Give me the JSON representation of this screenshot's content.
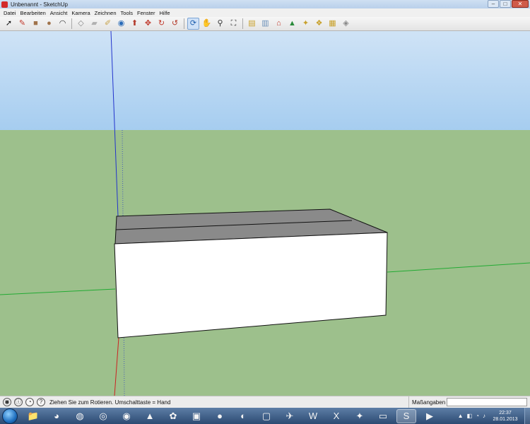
{
  "window": {
    "title": "Unbenannt - SketchUp",
    "minimize_glyph": "–",
    "maximize_glyph": "□",
    "close_glyph": "✕"
  },
  "menu": {
    "items": [
      "Datei",
      "Bearbeiten",
      "Ansicht",
      "Kamera",
      "Zeichnen",
      "Tools",
      "Fenster",
      "Hilfe"
    ]
  },
  "toolbar": {
    "tools": [
      {
        "name": "select-tool-icon",
        "glyph": "➚",
        "color": "#111111",
        "active": false
      },
      {
        "name": "pencil-tool-icon",
        "glyph": "✎",
        "color": "#c0392b",
        "active": false
      },
      {
        "name": "rectangle-tool-icon",
        "glyph": "■",
        "color": "#a0734b",
        "active": false
      },
      {
        "name": "circle-tool-icon",
        "glyph": "●",
        "color": "#a0734b",
        "active": false
      },
      {
        "name": "arc-tool-icon",
        "glyph": "◠",
        "color": "#333333",
        "active": false
      },
      {
        "name": "make-component-icon",
        "glyph": "◇",
        "color": "#888888",
        "active": false
      },
      {
        "name": "eraser-tool-icon",
        "glyph": "▰",
        "color": "#b0b0b0",
        "active": false
      },
      {
        "name": "tape-measure-icon",
        "glyph": "✐",
        "color": "#c8a24a",
        "active": false
      },
      {
        "name": "paint-bucket-icon",
        "glyph": "◉",
        "color": "#2a6bb8",
        "active": false
      },
      {
        "name": "push-pull-icon",
        "glyph": "⬆",
        "color": "#b33a2a",
        "active": false
      },
      {
        "name": "move-tool-icon",
        "glyph": "✥",
        "color": "#c0392b",
        "active": false
      },
      {
        "name": "rotate-tool-icon",
        "glyph": "↻",
        "color": "#c0392b",
        "active": false
      },
      {
        "name": "follow-me-icon",
        "glyph": "↺",
        "color": "#b33a2a",
        "active": false
      },
      {
        "name": "orbit-tool-icon",
        "glyph": "⟳",
        "color": "#1f5fae",
        "active": true
      },
      {
        "name": "pan-hand-icon",
        "glyph": "✋",
        "color": "#555555",
        "active": false
      },
      {
        "name": "zoom-tool-icon",
        "glyph": "⚲",
        "color": "#333333",
        "active": false
      },
      {
        "name": "zoom-extents-icon",
        "glyph": "⛶",
        "color": "#333333",
        "active": false
      },
      {
        "name": "get-models-icon",
        "glyph": "▤",
        "color": "#c8a02a",
        "active": false
      },
      {
        "name": "share-model-icon",
        "glyph": "▥",
        "color": "#6a8fb8",
        "active": false
      },
      {
        "name": "add-location-icon",
        "glyph": "⌂",
        "color": "#c0392b",
        "active": false
      },
      {
        "name": "toggle-terrain-icon",
        "glyph": "▲",
        "color": "#2a8a3a",
        "active": false
      },
      {
        "name": "get-photo-texture-icon",
        "glyph": "✦",
        "color": "#c8a02a",
        "active": false
      },
      {
        "name": "component-browser-icon",
        "glyph": "❖",
        "color": "#c8a02a",
        "active": false
      },
      {
        "name": "extension-warehouse-icon",
        "glyph": "▦",
        "color": "#c8a02a",
        "active": false
      },
      {
        "name": "sandbox-icon",
        "glyph": "◈",
        "color": "#888888",
        "active": false
      }
    ]
  },
  "scene": {
    "sky_color": "#cfe3f6",
    "horizon_sky_color": "#a6cdf0",
    "ground_color": "#9dc08c",
    "box_front_color": "#ffffff",
    "box_top_color": "#8a8a8a",
    "box_top_light_color": "#9a9a9a",
    "axis_blue_color": "#2233cc",
    "axis_green_color": "#22aa33",
    "axis_red_color": "#cc2222"
  },
  "status": {
    "hint_text": "Ziehen Sie zum Rotieren.  Umschalttaste = Hand",
    "measurements_label": "Maßangaben",
    "measurements_value": ""
  },
  "taskbar": {
    "apps": [
      {
        "name": "explorer-icon",
        "glyph": "📁",
        "active": false
      },
      {
        "name": "image-viewer-icon",
        "glyph": "◕",
        "active": false
      },
      {
        "name": "media-icon",
        "glyph": "◍",
        "active": false
      },
      {
        "name": "browser-icon",
        "glyph": "◎",
        "active": false
      },
      {
        "name": "disc-icon",
        "glyph": "◉",
        "active": false
      },
      {
        "name": "vlc-icon",
        "glyph": "▲",
        "active": false
      },
      {
        "name": "gimp-icon",
        "glyph": "✿",
        "active": false
      },
      {
        "name": "pdf-icon",
        "glyph": "▣",
        "active": false
      },
      {
        "name": "recorder-icon",
        "glyph": "●",
        "active": false
      },
      {
        "name": "settings-icon",
        "glyph": "◐",
        "active": false
      },
      {
        "name": "docs-icon",
        "glyph": "▢",
        "active": false
      },
      {
        "name": "jet-icon",
        "glyph": "✈",
        "active": false
      },
      {
        "name": "word-icon",
        "glyph": "W",
        "active": false
      },
      {
        "name": "excel-icon",
        "glyph": "X",
        "active": false
      },
      {
        "name": "fox-icon",
        "glyph": "✦",
        "active": false
      },
      {
        "name": "terminal-icon",
        "glyph": "▭",
        "active": false
      },
      {
        "name": "sketchup-icon",
        "glyph": "S",
        "active": true
      },
      {
        "name": "media-player-icon",
        "glyph": "▶",
        "active": false
      }
    ],
    "clock_time": "22:37",
    "clock_date": "28.01.2013",
    "tray_glyphs": [
      "▲",
      "◧",
      "◔",
      "♪"
    ]
  }
}
